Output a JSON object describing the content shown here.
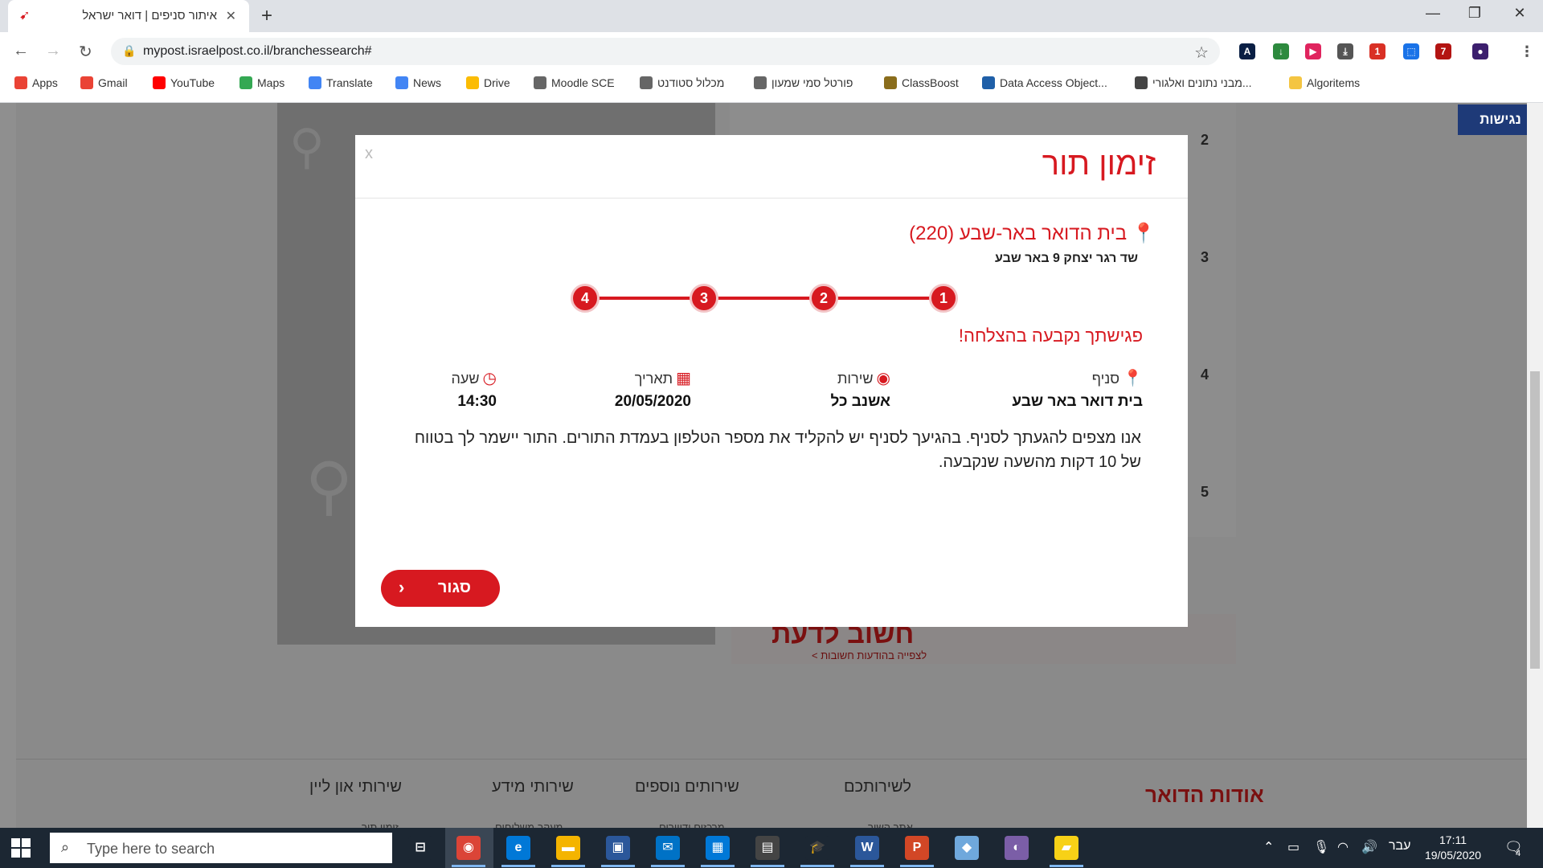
{
  "browser": {
    "tab_title": "איתור סניפים | דואר ישראל",
    "tab_close": "✕",
    "new_tab": "+",
    "url": "mypost.israelpost.co.il/branchessearch#",
    "window": {
      "minimize": "—",
      "maximize": "❐",
      "close": "✕"
    },
    "nav": {
      "back": "←",
      "forward": "→",
      "reload": "↻"
    },
    "extensions": [
      {
        "icon": "A",
        "color": "#0a1f44"
      },
      {
        "icon": "↓",
        "color": "#2d8a3e"
      },
      {
        "icon": "▶",
        "color": "#e0245e"
      },
      {
        "icon": "⤓",
        "color": "#555555"
      },
      {
        "icon": "1",
        "color": "#d93025"
      },
      {
        "icon": "⬚",
        "color": "#1a73e8"
      },
      {
        "icon": "7",
        "color": "#b31412"
      },
      {
        "icon": "●",
        "color": "#3c1f6e"
      },
      {
        "icon": "⋮",
        "color": "#ffffff"
      }
    ]
  },
  "bookmarks": [
    {
      "label": "Apps",
      "icon": "apps-icon",
      "color": "#ea4335"
    },
    {
      "label": "Gmail",
      "icon": "gmail-icon",
      "color": "#ea4335"
    },
    {
      "label": "YouTube",
      "icon": "youtube-icon",
      "color": "#ff0000"
    },
    {
      "label": "Maps",
      "icon": "maps-icon",
      "color": "#34a853"
    },
    {
      "label": "Translate",
      "icon": "translate-icon",
      "color": "#4285f4"
    },
    {
      "label": "News",
      "icon": "news-icon",
      "color": "#4285f4"
    },
    {
      "label": "Drive",
      "icon": "drive-icon",
      "color": "#fbbc04"
    },
    {
      "label": "Moodle SCE",
      "icon": "sce-icon",
      "color": "#666666"
    },
    {
      "label": "מכלול סטודנט",
      "icon": "sce-icon",
      "color": "#666666"
    },
    {
      "label": "פורטל סמי שמעון",
      "icon": "sce-icon",
      "color": "#666666"
    },
    {
      "label": "ClassBoost",
      "icon": "classboost-icon",
      "color": "#8a6d1c"
    },
    {
      "label": "Data Access Object...",
      "icon": "dao-icon",
      "color": "#1f5fa8"
    },
    {
      "label": "מבני נתונים ואלגורי...",
      "icon": "book-icon",
      "color": "#444444"
    },
    {
      "label": "Algoritems",
      "icon": "folder-icon",
      "color": "#f4c542"
    }
  ],
  "page": {
    "accessibility": "נגישות",
    "list_numbers": [
      "2",
      "3",
      "4",
      "5"
    ],
    "banner_big": "חשוב לדעת",
    "banner_small": "לצפייה בהודעות חשובות >",
    "footer": {
      "about": "אודות הדואר",
      "col1": "לשירותכם",
      "col2": "שירותים נוספים",
      "col3": "שירותי מידע",
      "col4": "שירותי און ליין",
      "col1_sub": "אתר השיר",
      "col2_sub": "מרכזים ודיוורים",
      "col3_sub": "מעקב משלוחים",
      "col4_sub": "זימון תור"
    }
  },
  "modal": {
    "close_x": "x",
    "title": "זימון תור",
    "branch_name": "בית הדואר באר-שבע (220)",
    "branch_address": "שד רגר יצחק 9 באר שבע",
    "steps": [
      "1",
      "2",
      "3",
      "4"
    ],
    "success": "פגישתך נקבעה בהצלחה!",
    "details": {
      "branch_label": "סניף",
      "branch_value": "בית דואר באר שבע",
      "service_label": "שירות",
      "service_value": "אשנב כל",
      "date_label": "תאריך",
      "date_value": "20/05/2020",
      "time_label": "שעה",
      "time_value": "14:30"
    },
    "note": "אנו מצפים להגעתך לסניף. בהגיעך לסניף יש להקליד את מספר הטלפון בעמדת התורים. התור יישמר לך בטווח של 10 דקות מהשעה שנקבעה.",
    "close_button": "סגור"
  },
  "taskbar": {
    "search_placeholder": "Type here to search",
    "lang": "עבר",
    "time": "17:11",
    "date": "19/05/2020",
    "notifications": "4"
  }
}
